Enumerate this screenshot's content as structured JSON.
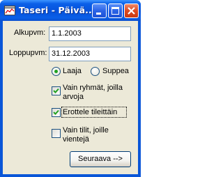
{
  "window": {
    "title": "Taseri - Päivä...",
    "icon": "chart-app-icon",
    "controls": {
      "minimize": "minimize-icon",
      "maximize": "maximize-icon",
      "close": "close-icon"
    }
  },
  "form": {
    "start_label": "Alkupvm:",
    "start_value": "1.1.2003",
    "end_label": "Loppupvm:",
    "end_value": "31.12.2003",
    "scope": {
      "options": [
        {
          "label": "Laaja",
          "selected": true
        },
        {
          "label": "Suppea",
          "selected": false
        }
      ]
    },
    "checkboxes": [
      {
        "line1": "Vain ryhmät, joilla",
        "line2": "arvoja",
        "checked": true
      },
      {
        "line1": "Erottele tileittäin",
        "line2": "",
        "checked": true,
        "focused": true
      },
      {
        "line1": "Vain tilit, joille",
        "line2": "vientejä",
        "checked": false
      }
    ],
    "next_button": "Seuraava -->"
  },
  "colors": {
    "titlebar": "#0a56d8",
    "client": "#ece9d8",
    "radio_dot": "#21a121",
    "check_mark": "#21a121"
  }
}
